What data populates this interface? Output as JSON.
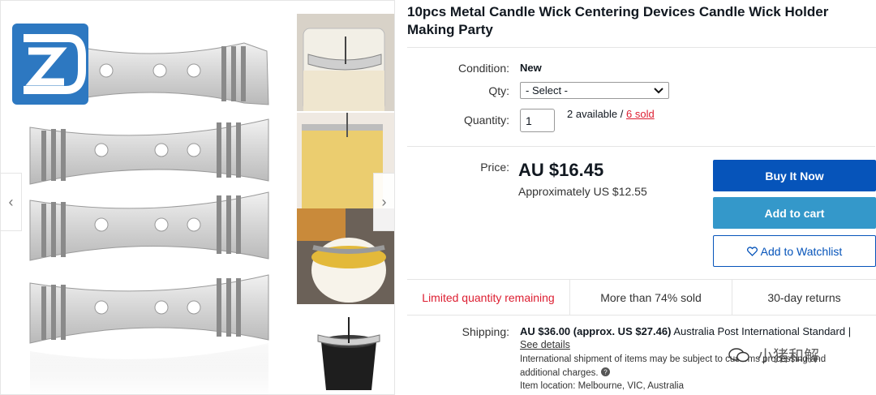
{
  "listing": {
    "title": "10pcs Metal Candle Wick Centering Devices Candle Wick Holder Making Party"
  },
  "gallery": {
    "prev_icon": "‹",
    "next_icon": "›",
    "logo_icon": "brand-logo-icon"
  },
  "details": {
    "condition_label": "Condition:",
    "condition_value": "New",
    "qty_select_label": "Qty:",
    "qty_select_value": "- Select -",
    "quantity_label": "Quantity:",
    "quantity_value": "1",
    "available_text": "2 available /",
    "sold_text": "6 sold"
  },
  "pricing": {
    "price_label": "Price:",
    "price": "AU $16.45",
    "approx": "Approximately US $12.55"
  },
  "actions": {
    "buy_now": "Buy It Now",
    "add_to_cart": "Add to cart",
    "watchlist": "Add to Watchlist",
    "watchlist_icon": "heart-icon"
  },
  "highlights": {
    "limited": "Limited quantity remaining",
    "sold_percent": "More than 74% sold",
    "returns": "30-day returns"
  },
  "shipping": {
    "label": "Shipping:",
    "price": "AU $36.00",
    "approx": "(approx. US $27.46)",
    "method": "Australia Post International Standard |",
    "see_details": "See details",
    "intl_note_1": "International shipment of items may be subject to customs processing and",
    "intl_note_2": "additional charges.",
    "help_icon": "question-circle-icon",
    "location": "Item location:  Melbourne, VIC, Australia"
  },
  "watermark": {
    "text": "小猪和解"
  },
  "colors": {
    "primary_blue": "#0654ba",
    "cart_blue": "#3498ca",
    "alert_red": "#dd1e31",
    "logo_blue": "#2d78c1"
  }
}
